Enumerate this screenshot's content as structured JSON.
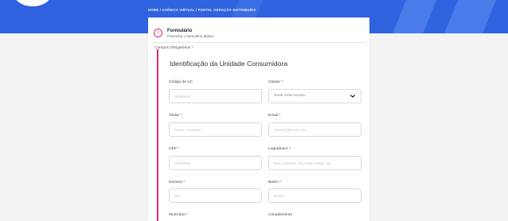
{
  "breadcrumb": "HOME / AGÊNCIA VIRTUAL / PORTAL GERAÇÃO DISTRIBUÍDA",
  "form_header": {
    "info_icon_glyph": "!",
    "title": "Formulário",
    "subtitle": "Preencha o formulário abaixo"
  },
  "required_note": "Campos Obrigatórios *",
  "section_title": "Identificação da Unidade Consumidora",
  "fields": {
    "codigo_uc": {
      "label": "Código de UC",
      "placeholder": "00000000"
    },
    "classe": {
      "label": "Classe *",
      "value": "Nada Selecionado"
    },
    "titular": {
      "label": "Titular *",
      "placeholder": "Nome Completo"
    },
    "email": {
      "label": "Email *",
      "placeholder": "usuario@email.com"
    },
    "cep": {
      "label": "CEP *",
      "placeholder": "00000000"
    },
    "logradouro": {
      "label": "Logradouro *",
      "placeholder": "Rua, Avenida, Travessa, Praça, etc."
    },
    "numero": {
      "label": "Número *",
      "placeholder": "000"
    },
    "bairro": {
      "label": "Bairro *",
      "placeholder": "Bairro"
    },
    "municipio": {
      "label": "Município *"
    },
    "complemento": {
      "label": "Complemento"
    }
  },
  "colors": {
    "banner": "#2f63e0",
    "accent": "#e1277c"
  }
}
